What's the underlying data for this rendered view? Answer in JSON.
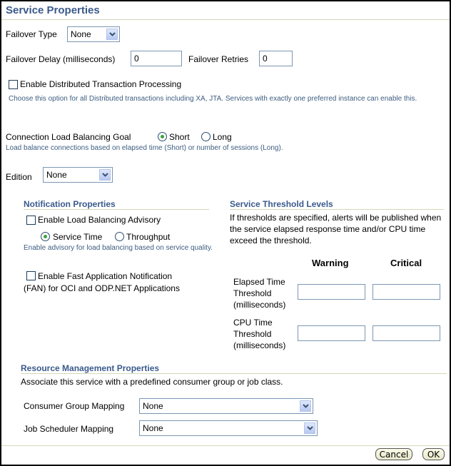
{
  "page": {
    "title": "Service Properties"
  },
  "failover": {
    "type_label": "Failover Type",
    "type_value": "None",
    "delay_label": "Failover Delay (milliseconds)",
    "delay_value": "0",
    "retries_label": "Failover Retries",
    "retries_value": "0"
  },
  "dtp": {
    "label": "Enable Distributed Transaction Processing",
    "checked": false,
    "hint": "Choose this option for all Distributed transactions including XA, JTA. Services with exactly one preferred instance can enable this."
  },
  "clb": {
    "label": "Connection Load Balancing Goal",
    "options": [
      {
        "label": "Short",
        "selected": true
      },
      {
        "label": "Long",
        "selected": false
      }
    ],
    "hint": "Load balance connections based on elapsed time (Short) or number of sessions (Long)."
  },
  "edition": {
    "label": "Edition",
    "value": "None"
  },
  "notification": {
    "heading": "Notification Properties",
    "lba_label": "Enable Load Balancing Advisory",
    "lba_checked": false,
    "lba_options": [
      {
        "label": "Service Time",
        "selected": true
      },
      {
        "label": "Throughput",
        "selected": false
      }
    ],
    "lba_hint": "Enable advisory for load balancing based on service quality.",
    "fan_label_line1": "Enable Fast Application Notification",
    "fan_label_line2": "(FAN) for OCI and ODP.NET Applications",
    "fan_checked": false
  },
  "threshold": {
    "heading": "Service Threshold Levels",
    "description": "If thresholds are specified, alerts will be published when the service elapsed response time and/or CPU time exceed the threshold.",
    "col_warning": "Warning",
    "col_critical": "Critical",
    "rows": [
      {
        "label": [
          "Elapsed Time",
          "Threshold",
          "(milliseconds)"
        ],
        "warning": "",
        "critical": ""
      },
      {
        "label": [
          "CPU Time",
          "Threshold",
          "(milliseconds)"
        ],
        "warning": "",
        "critical": ""
      }
    ]
  },
  "resource": {
    "heading": "Resource Management Properties",
    "description": "Associate this service with a predefined consumer group or job class.",
    "consumer_label": "Consumer Group Mapping",
    "consumer_value": "None",
    "job_label": "Job Scheduler Mapping",
    "job_value": "None"
  },
  "buttons": {
    "cancel": "Cancel",
    "ok": "OK"
  }
}
